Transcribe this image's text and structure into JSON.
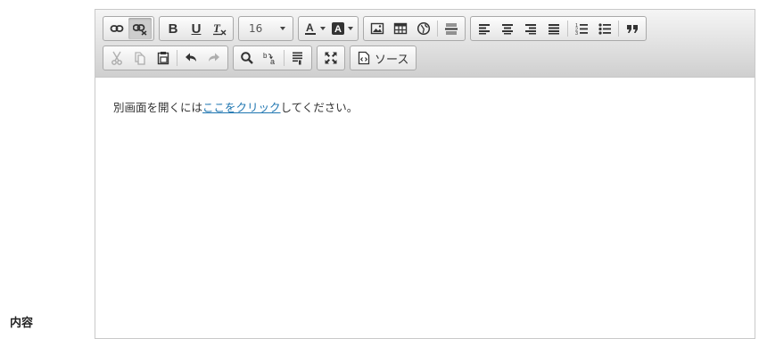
{
  "page": {
    "field_label": "内容"
  },
  "editor": {
    "font_size_value": "16",
    "source_label": "ソース",
    "content": {
      "prefix": "別画面を開くには",
      "link_text": "ここをクリック",
      "suffix": "してください。"
    }
  },
  "toolbar_icons": [
    "link-icon",
    "unlink-icon",
    "bold-icon",
    "underline-icon",
    "remove-format-icon",
    "text-color-icon",
    "background-color-icon",
    "image-icon",
    "table-icon",
    "iframe-icon",
    "horizontal-rule-icon",
    "align-left-icon",
    "align-center-icon",
    "align-right-icon",
    "justify-icon",
    "numbered-list-icon",
    "bulleted-list-icon",
    "blockquote-icon",
    "cut-icon",
    "copy-icon",
    "paste-icon",
    "undo-icon",
    "redo-icon",
    "find-icon",
    "replace-icon",
    "page-break-icon",
    "maximize-icon",
    "source-icon"
  ],
  "colors": {
    "link": "#1e75b0",
    "toolbar_top": "#f5f5f5",
    "toolbar_bottom": "#cfcfcf"
  }
}
